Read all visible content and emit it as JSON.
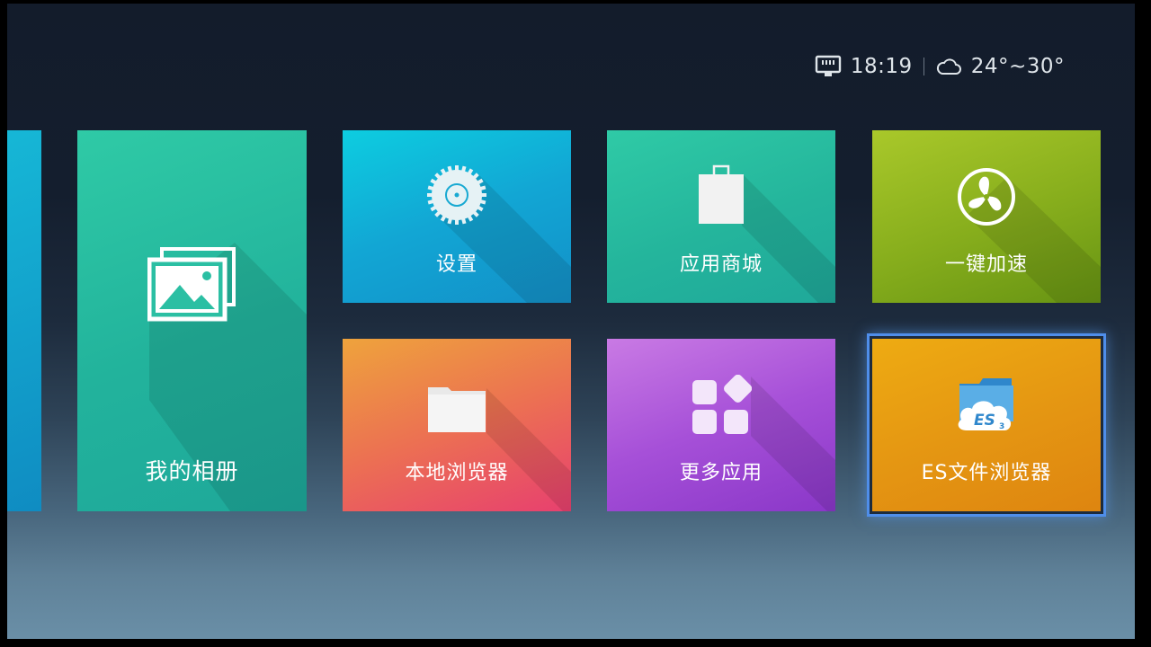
{
  "status_bar": {
    "time": "18:19",
    "temperature": "24°~30°",
    "network_icon": "ethernet-icon",
    "weather_icon": "cloud-icon"
  },
  "tiles": [
    {
      "id": "album",
      "label": "我的相册",
      "icon": "photo-album-icon",
      "color_from": "#2fcaa6",
      "color_to": "#1ea89a"
    },
    {
      "id": "settings",
      "label": "设置",
      "icon": "gear-icon",
      "color_from": "#0dcde0",
      "color_to": "#1390c8"
    },
    {
      "id": "store",
      "label": "应用商城",
      "icon": "shopping-bag-icon",
      "color_from": "#2fcaa6",
      "color_to": "#1fa89a"
    },
    {
      "id": "boost",
      "label": "一键加速",
      "icon": "fan-icon",
      "color_from": "#a9c82a",
      "color_to": "#679413"
    },
    {
      "id": "browser",
      "label": "本地浏览器",
      "icon": "folder-icon",
      "color_from": "#eea33c",
      "color_to": "#e7406f"
    },
    {
      "id": "more",
      "label": "更多应用",
      "icon": "apps-grid-icon",
      "color_from": "#c97ae4",
      "color_to": "#8a37c8"
    },
    {
      "id": "es",
      "label": "ES文件浏览器",
      "icon": "es-file-explorer-icon",
      "color_from": "#eeab12",
      "color_to": "#de8510",
      "focused": true
    }
  ],
  "focus_color": "#4f8eea"
}
